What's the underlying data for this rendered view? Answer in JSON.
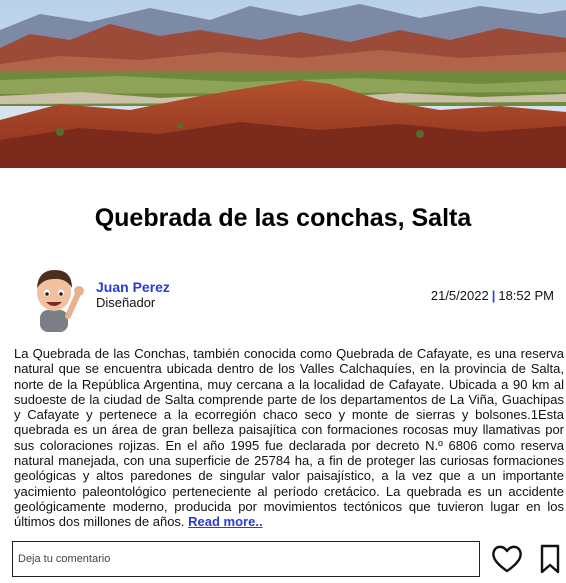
{
  "post": {
    "title": "Quebrada de las conchas, Salta",
    "author": {
      "name": "Juan Perez",
      "role": "Diseñador"
    },
    "date": "21/5/2022",
    "separator": "|",
    "time": "18:52 PM",
    "body": "La Quebrada de las Conchas, también conocida como Quebrada de Cafayate, es una reserva natural que se encuentra ubicada dentro de los Valles Calchaquíes, en la provincia de Salta, norte de la República Argentina, muy cercana a la localidad de Cafayate. Ubicada a 90 km al sudoeste de la ciudad de Salta comprende parte de los departamentos de La Viña, Guachipas y Cafayate y pertenece a la ecorregión chaco seco y monte de sierras y bolsones.1Esta quebrada es un área de gran belleza paisajítica con formaciones rocosas muy llamativas por sus coloraciones rojizas. En el año 1995 fue declarada por decreto N.º 6806 como reserva natural manejada, con una superficie de 25784 ha, a fin de proteger las curiosas formaciones geológicas y altos paredones de singular valor paisajístico, a la vez que a un importante yacimiento paleontológico perteneciente al período cretácico. La quebrada es un accidente geológicamente moderno, producida por movimientos tectónicos que tuvieron lugar en los últimos dos millones de años.",
    "read_more": "Read more.."
  },
  "comment": {
    "placeholder": "Deja tu comentario",
    "value": ""
  },
  "actions": {
    "like_icon": "heart-outline",
    "save_icon": "bookmark-outline"
  },
  "colors": {
    "accent": "#2a3bd6",
    "rock": "#a4432a",
    "sky": "#c9dcef"
  }
}
